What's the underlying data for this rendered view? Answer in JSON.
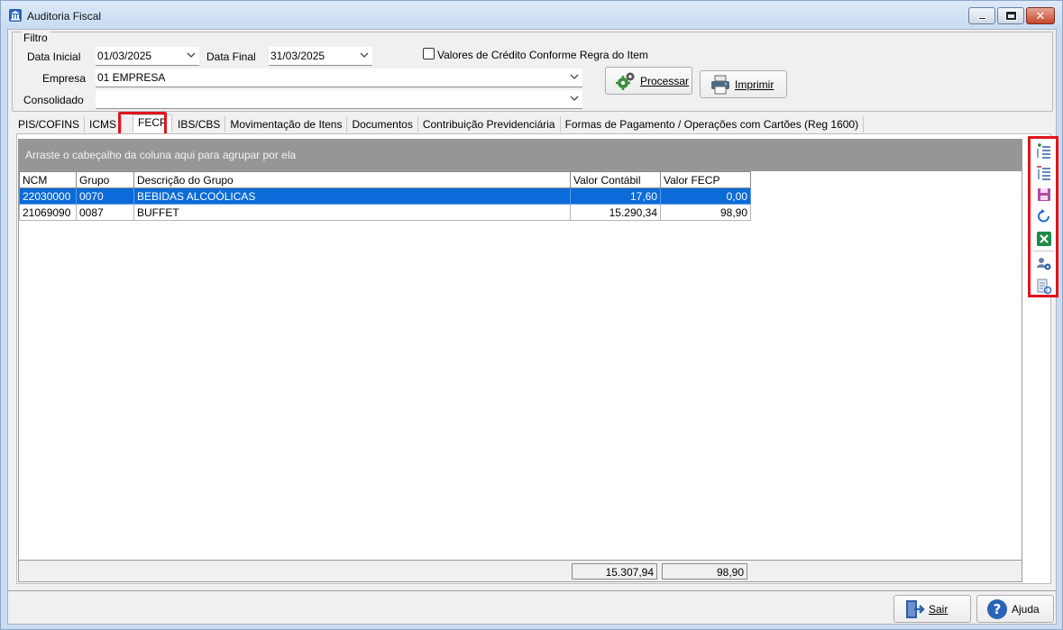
{
  "window": {
    "title": "Auditoria Fiscal"
  },
  "filter": {
    "legend": "Filtro",
    "data_inicial_label": "Data Inicial",
    "data_inicial_value": "01/03/2025",
    "data_final_label": "Data Final",
    "data_final_value": "31/03/2025",
    "credito_label": "Valores de Crédito Conforme Regra do Item",
    "empresa_label": "Empresa",
    "empresa_value": "01 EMPRESA",
    "consolidado_label": "Consolidado",
    "consolidado_value": ""
  },
  "buttons": {
    "processar": "Processar",
    "imprimir": "Imprimir",
    "sair": "Sair",
    "ajuda": "Ajuda"
  },
  "tabs": [
    {
      "label": "PIS/COFINS"
    },
    {
      "label": "ICMS"
    },
    {
      "label": "FECP"
    },
    {
      "label": "IBS/CBS"
    },
    {
      "label": "Movimentação de Itens"
    },
    {
      "label": "Documentos"
    },
    {
      "label": "Contribuição Previdenciária"
    },
    {
      "label": "Formas de Pagamento / Operações com Cartões  (Reg 1600)"
    }
  ],
  "grid": {
    "group_hint": "Arraste o cabeçalho da coluna aqui para agrupar por ela",
    "columns": [
      "NCM",
      "Grupo",
      "Descrição do Grupo",
      "Valor Contábil",
      "Valor FECP"
    ],
    "rows": [
      [
        "22030000",
        "0070",
        "BEBIDAS ALCOÓLICAS",
        "17,60",
        "0,00"
      ],
      [
        "21069090",
        "0087",
        "BUFFET",
        "15.290,34",
        "98,90"
      ]
    ],
    "totals": {
      "valor_contabil": "15.307,94",
      "valor_fecp": "98,90"
    }
  },
  "toolbar_icons": [
    "add-rows-icon",
    "remove-rows-icon",
    "save-icon",
    "refresh-icon",
    "excel-export-icon",
    "users-config-icon",
    "document-refresh-icon"
  ],
  "colors": {
    "selection": "#0b6bd8",
    "highlight": "#e0141e",
    "group_bar": "#969696"
  }
}
